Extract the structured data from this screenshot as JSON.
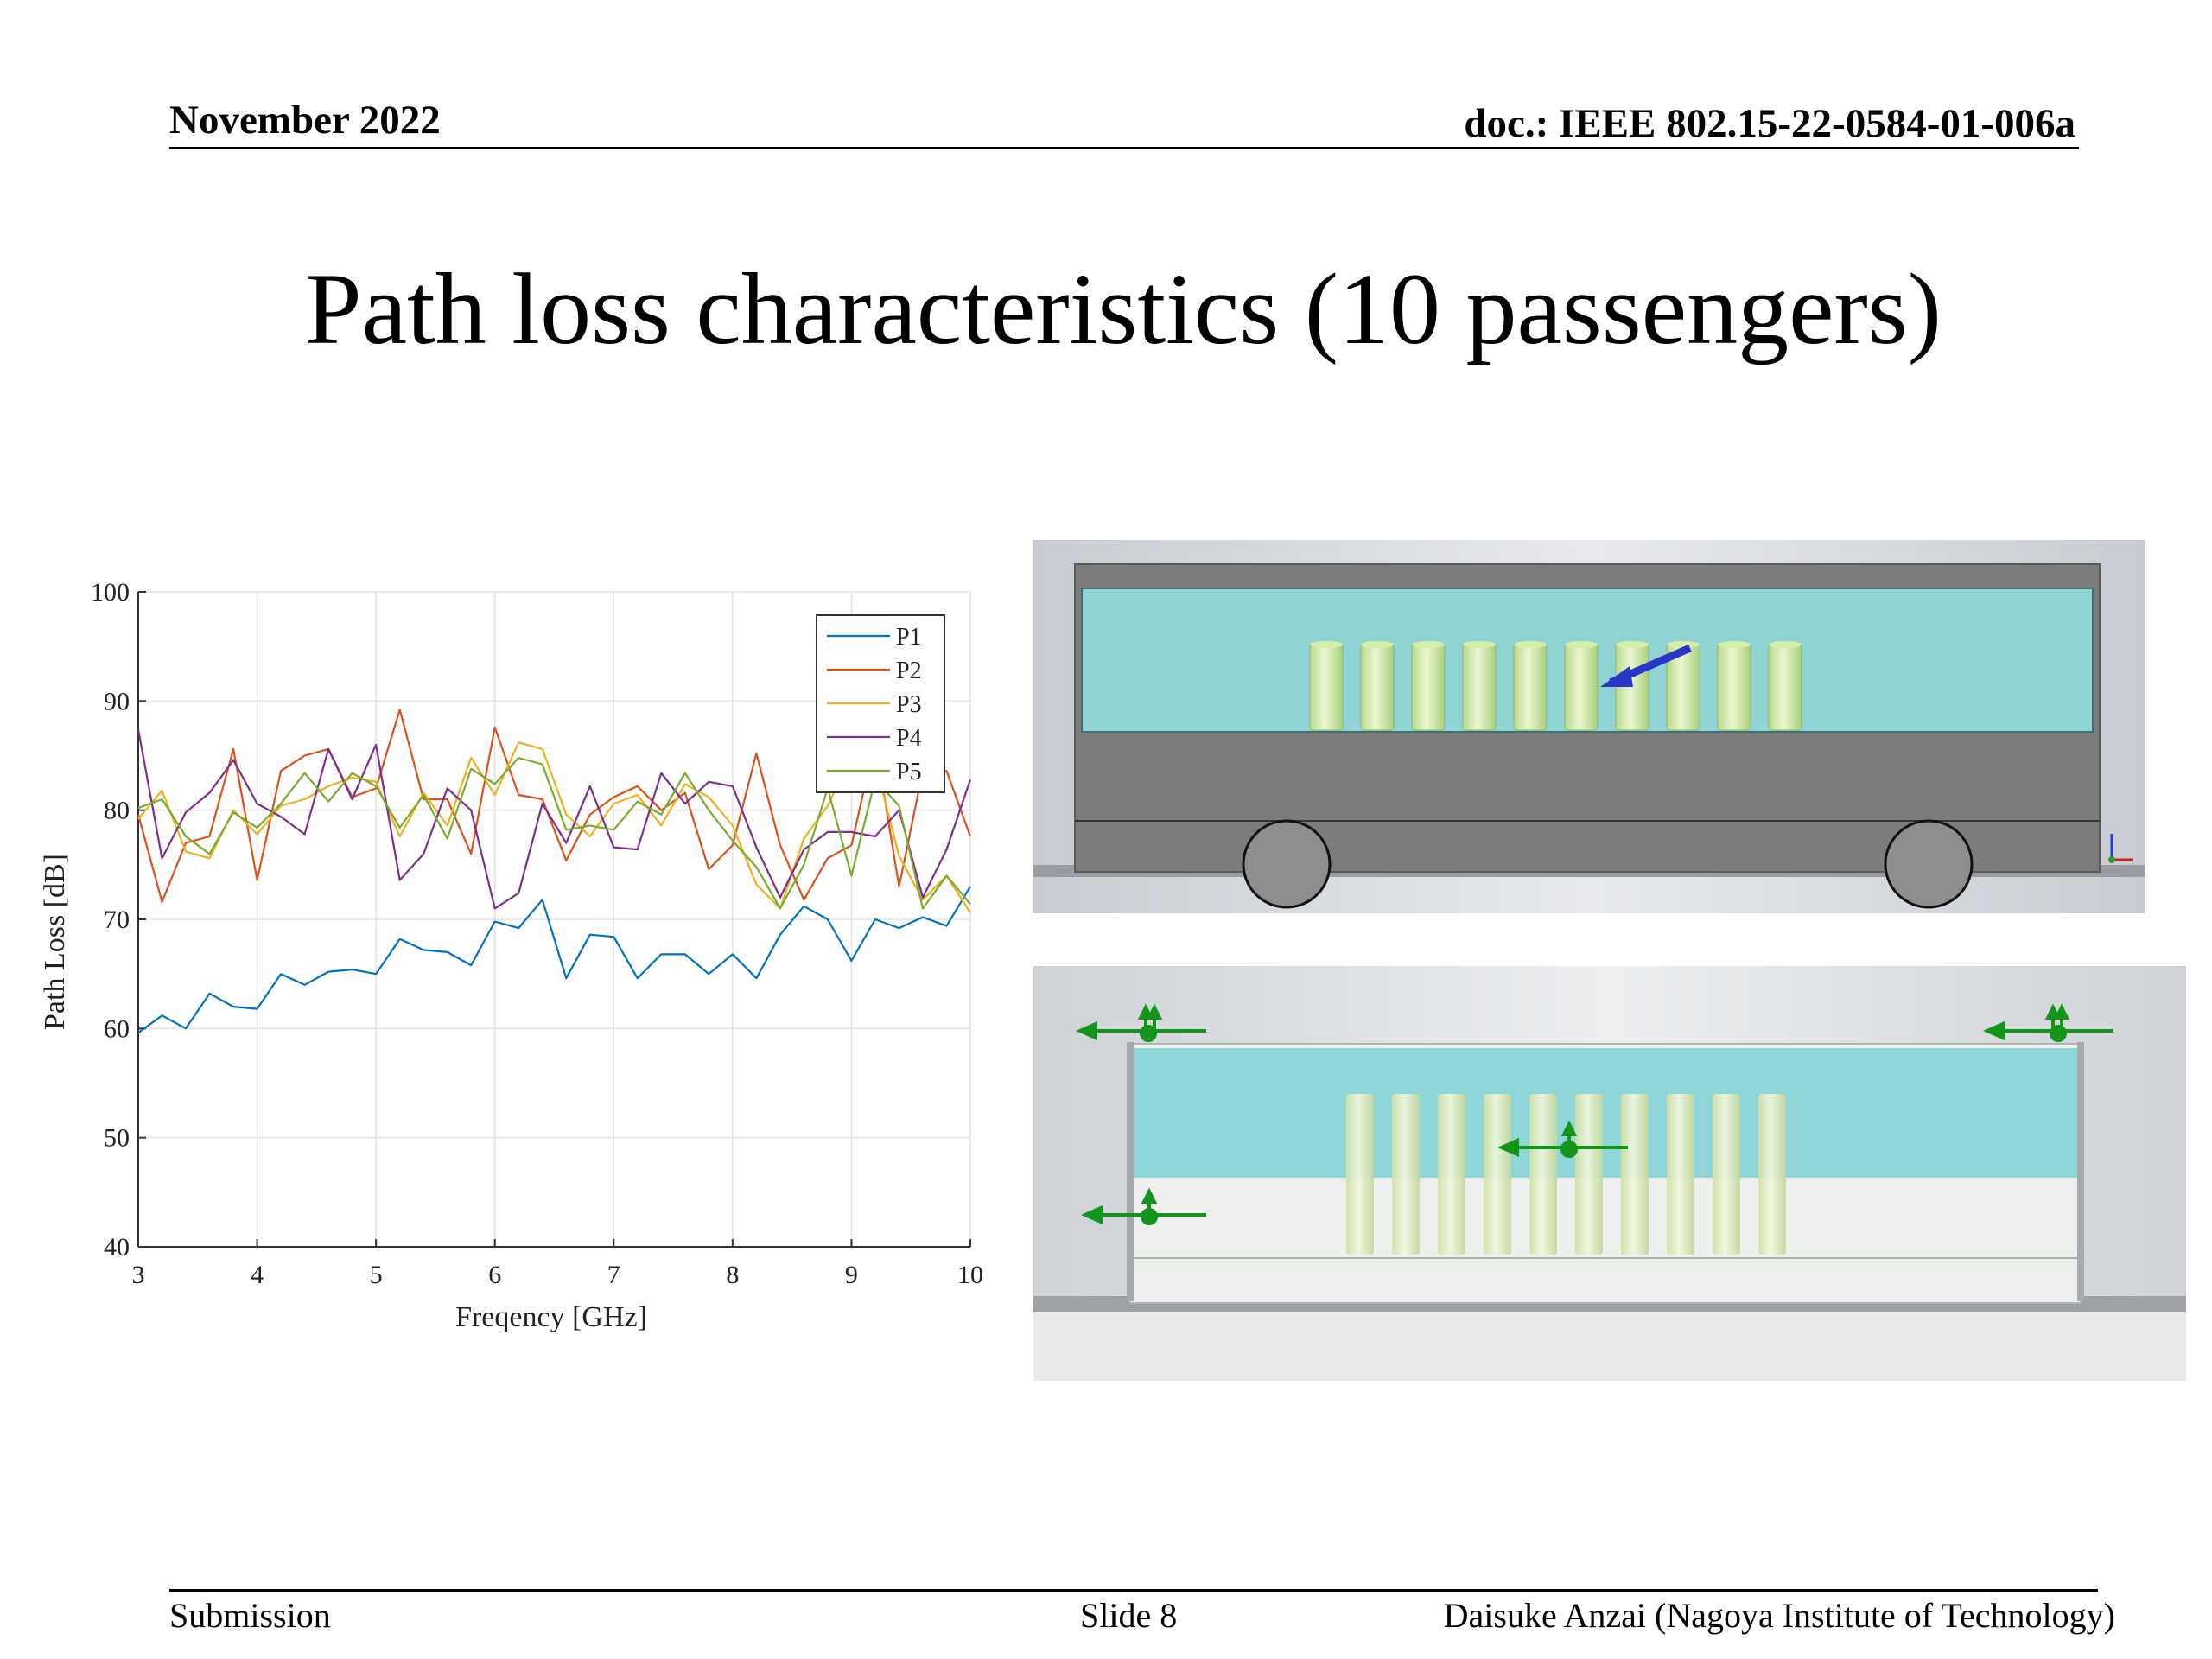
{
  "header": {
    "date": "November 2022",
    "doc": "doc.: IEEE 802.15-22-0584-01-006a"
  },
  "slide_title": "Path loss characteristics (10 passengers)",
  "footer": {
    "left": "Submission",
    "center": "Slide 8",
    "right": "Daisuke Anzai (Nagoya Institute of Technology)"
  },
  "chart_data": {
    "type": "line",
    "xlabel": "Freqency [GHz]",
    "ylabel": "Path Loss [dB]",
    "xlim": [
      3,
      10
    ],
    "ylim": [
      40,
      100
    ],
    "xticks": [
      3,
      4,
      5,
      6,
      7,
      8,
      9,
      10
    ],
    "yticks": [
      40,
      50,
      60,
      70,
      80,
      90,
      100
    ],
    "grid": true,
    "legend_position": "top-right",
    "x": [
      3.0,
      3.2,
      3.4,
      3.6,
      3.8,
      4.0,
      4.2,
      4.4,
      4.6,
      4.8,
      5.0,
      5.2,
      5.4,
      5.6,
      5.8,
      6.0,
      6.2,
      6.4,
      6.6,
      6.8,
      7.0,
      7.2,
      7.4,
      7.6,
      7.8,
      8.0,
      8.2,
      8.4,
      8.6,
      8.8,
      9.0,
      9.2,
      9.4,
      9.6,
      9.8,
      10.0
    ],
    "series": [
      {
        "name": "P1",
        "color": "#0072BD",
        "values": [
          59.6,
          61.2,
          60.0,
          63.2,
          62.0,
          61.8,
          65.0,
          64.0,
          65.2,
          65.4,
          65.0,
          68.2,
          67.2,
          67.0,
          65.8,
          69.8,
          69.2,
          71.8,
          64.6,
          68.6,
          68.4,
          64.6,
          66.8,
          66.8,
          65.0,
          66.8,
          64.6,
          68.6,
          71.2,
          70.0,
          66.2,
          70.0,
          69.2,
          70.2,
          69.4,
          73.0
        ]
      },
      {
        "name": "P2",
        "color": "#D95319",
        "values": [
          79.6,
          71.6,
          77.0,
          77.6,
          85.6,
          73.6,
          83.6,
          85.0,
          85.6,
          81.2,
          82.0,
          89.2,
          81.0,
          81.0,
          76.0,
          87.6,
          81.4,
          81.0,
          75.4,
          79.6,
          81.2,
          82.2,
          80.0,
          81.6,
          74.6,
          76.8,
          85.2,
          76.8,
          71.8,
          75.6,
          76.8,
          86.4,
          73.0,
          83.6,
          83.6,
          77.6
        ]
      },
      {
        "name": "P3",
        "color": "#EDB120",
        "values": [
          79.2,
          81.8,
          76.2,
          75.6,
          80.0,
          77.8,
          80.4,
          81.0,
          82.2,
          83.0,
          82.6,
          77.6,
          81.6,
          78.6,
          84.8,
          81.4,
          86.2,
          85.6,
          79.6,
          77.6,
          80.6,
          81.4,
          78.6,
          82.4,
          81.2,
          78.6,
          73.2,
          71.0,
          77.4,
          80.4,
          85.0,
          84.4,
          75.8,
          71.8,
          74.0,
          70.6
        ]
      },
      {
        "name": "P4",
        "color": "#7E2F8E",
        "values": [
          87.4,
          75.6,
          79.8,
          81.6,
          84.6,
          80.6,
          79.4,
          77.8,
          85.6,
          81.0,
          86.0,
          73.6,
          76.0,
          82.0,
          80.0,
          71.0,
          72.4,
          80.6,
          77.0,
          82.2,
          76.6,
          76.4,
          83.4,
          80.6,
          82.6,
          82.2,
          76.6,
          72.0,
          76.4,
          78.0,
          78.0,
          77.6,
          80.0,
          72.0,
          76.4,
          82.8
        ]
      },
      {
        "name": "P5",
        "color": "#77AC30",
        "values": [
          80.2,
          81.0,
          77.6,
          76.0,
          79.8,
          78.4,
          80.6,
          83.4,
          80.8,
          83.4,
          82.2,
          78.4,
          81.4,
          77.4,
          83.8,
          82.4,
          84.8,
          84.2,
          78.2,
          78.6,
          78.2,
          80.8,
          79.6,
          83.4,
          80.0,
          77.2,
          74.8,
          71.0,
          75.0,
          82.0,
          74.0,
          82.8,
          80.4,
          71.0,
          74.0,
          71.4
        ]
      }
    ]
  }
}
